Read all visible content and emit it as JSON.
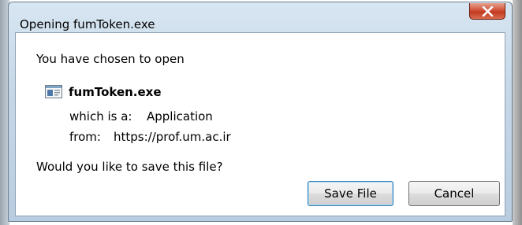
{
  "window": {
    "title": "Opening fumToken.exe"
  },
  "dialog": {
    "intro": "You have chosen to open",
    "file_name": "fumToken.exe",
    "type_label": "which is a:",
    "type_value": "Application",
    "from_label": "from:",
    "from_value": "https://prof.um.ac.ir",
    "question": "Would you like to save this file?"
  },
  "buttons": {
    "save": "Save File",
    "cancel": "Cancel"
  },
  "icons": {
    "close": "close-icon",
    "file": "application-file-icon"
  },
  "colors": {
    "close_button": "#c23a20",
    "titlebar": "#c6d7e7",
    "default_button_border": "#3c7fb1"
  }
}
